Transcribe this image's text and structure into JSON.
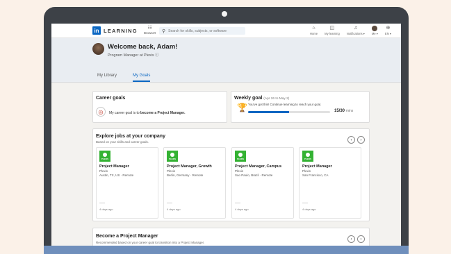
{
  "nav": {
    "logo_text": "LEARNING",
    "logo_badge": "in",
    "browse_label": "Browse▾",
    "search_placeholder": "Search for skills, subjects, or software",
    "items": [
      {
        "label": "Home",
        "icon": "home-icon"
      },
      {
        "label": "My learning",
        "icon": "bookmark-icon"
      },
      {
        "label": "Notifications ▾",
        "icon": "bell-icon"
      },
      {
        "label": "Me ▾",
        "icon": "avatar"
      },
      {
        "label": "EN ▾",
        "icon": "globe-icon"
      }
    ]
  },
  "profile": {
    "welcome": "Welcome back, Adam!",
    "subtitle": "Program Manager at Plexis  ⓘ"
  },
  "tabs": [
    {
      "label": "My Library",
      "active": false
    },
    {
      "label": "My Goals",
      "active": true
    }
  ],
  "career_goals": {
    "title": "Career goals",
    "text_prefix": "My career goal is to ",
    "text_bold": "become a Project Manager."
  },
  "weekly_goal": {
    "title": "Weekly goal",
    "date_range": "(Apr 26 to May 2)",
    "message": "You've got this! Continue learning to reach your goal.",
    "progress_fraction": 0.5,
    "progress_text": "15/30",
    "unit": "mins"
  },
  "explore_jobs": {
    "title": "Explore jobs at your company",
    "subtitle": "Based on your skills and career goals.",
    "jobs": [
      {
        "logo": "PLEXIS",
        "title": "Project Manager",
        "company": "Plexis",
        "location": "Austin, TX, US · Remote",
        "age": "4 days ago"
      },
      {
        "logo": "PLEXIS",
        "title": "Project Manager, Growth",
        "company": "Plexis",
        "location": "Berlin, Germany · Remote",
        "age": "4 days ago"
      },
      {
        "logo": "PLEXIS",
        "title": "Project Manager, Campus",
        "company": "Plexis",
        "location": "Sao Paulo, Brazil · Remote",
        "age": "4 days ago"
      },
      {
        "logo": "PLEXIS",
        "title": "Project Manager",
        "company": "Plexis",
        "location": "San Francisco, CA",
        "age": "4 days ago"
      }
    ]
  },
  "become_pm": {
    "title": "Become a Project Manager",
    "subtitle": "Recommended based on your career goal to transition into a Project Manager."
  },
  "colors": {
    "accent": "#0a66c2",
    "plexis_green": "#34b233",
    "background": "#fbf1e8",
    "laptop_frame": "#3d4147"
  }
}
